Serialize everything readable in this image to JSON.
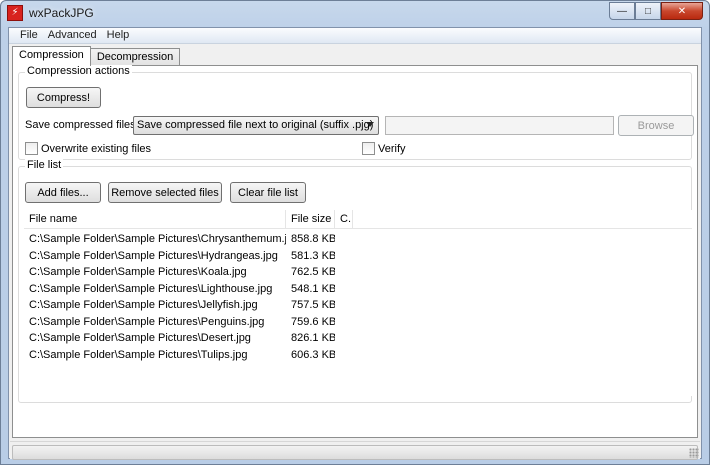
{
  "window": {
    "title": "wxPackJPG",
    "caption": {
      "minimize": "—",
      "maximize": "□",
      "close": "✕"
    }
  },
  "menu": [
    "File",
    "Advanced",
    "Help"
  ],
  "tabs": [
    {
      "label": "Compression",
      "active": true
    },
    {
      "label": "Decompression",
      "active": false
    }
  ],
  "compression_actions": {
    "title": "Compression actions",
    "compress_button": "Compress!",
    "save_label": "Save compressed files:",
    "save_option": "Save compressed file next to original (suffix .pjg)",
    "browse_button": "Browse",
    "overwrite_label": "Overwrite existing files",
    "verify_label": "Verify"
  },
  "file_list": {
    "title": "File list",
    "add_button": "Add files...",
    "remove_button": "Remove selected files",
    "clear_button": "Clear file list",
    "columns": [
      "File name",
      "File size",
      "C.."
    ],
    "rows": [
      {
        "name": "C:\\Sample Folder\\Sample Pictures\\Chrysanthemum.jpg",
        "size": "858.8 KB"
      },
      {
        "name": "C:\\Sample Folder\\Sample Pictures\\Hydrangeas.jpg",
        "size": "581.3 KB"
      },
      {
        "name": "C:\\Sample Folder\\Sample Pictures\\Koala.jpg",
        "size": "762.5 KB"
      },
      {
        "name": "C:\\Sample Folder\\Sample Pictures\\Lighthouse.jpg",
        "size": "548.1 KB"
      },
      {
        "name": "C:\\Sample Folder\\Sample Pictures\\Jellyfish.jpg",
        "size": "757.5 KB"
      },
      {
        "name": "C:\\Sample Folder\\Sample Pictures\\Penguins.jpg",
        "size": "759.6 KB"
      },
      {
        "name": "C:\\Sample Folder\\Sample Pictures\\Desert.jpg",
        "size": "826.1 KB"
      },
      {
        "name": "C:\\Sample Folder\\Sample Pictures\\Tulips.jpg",
        "size": "606.3 KB"
      }
    ]
  },
  "progress": {
    "value": 0
  }
}
